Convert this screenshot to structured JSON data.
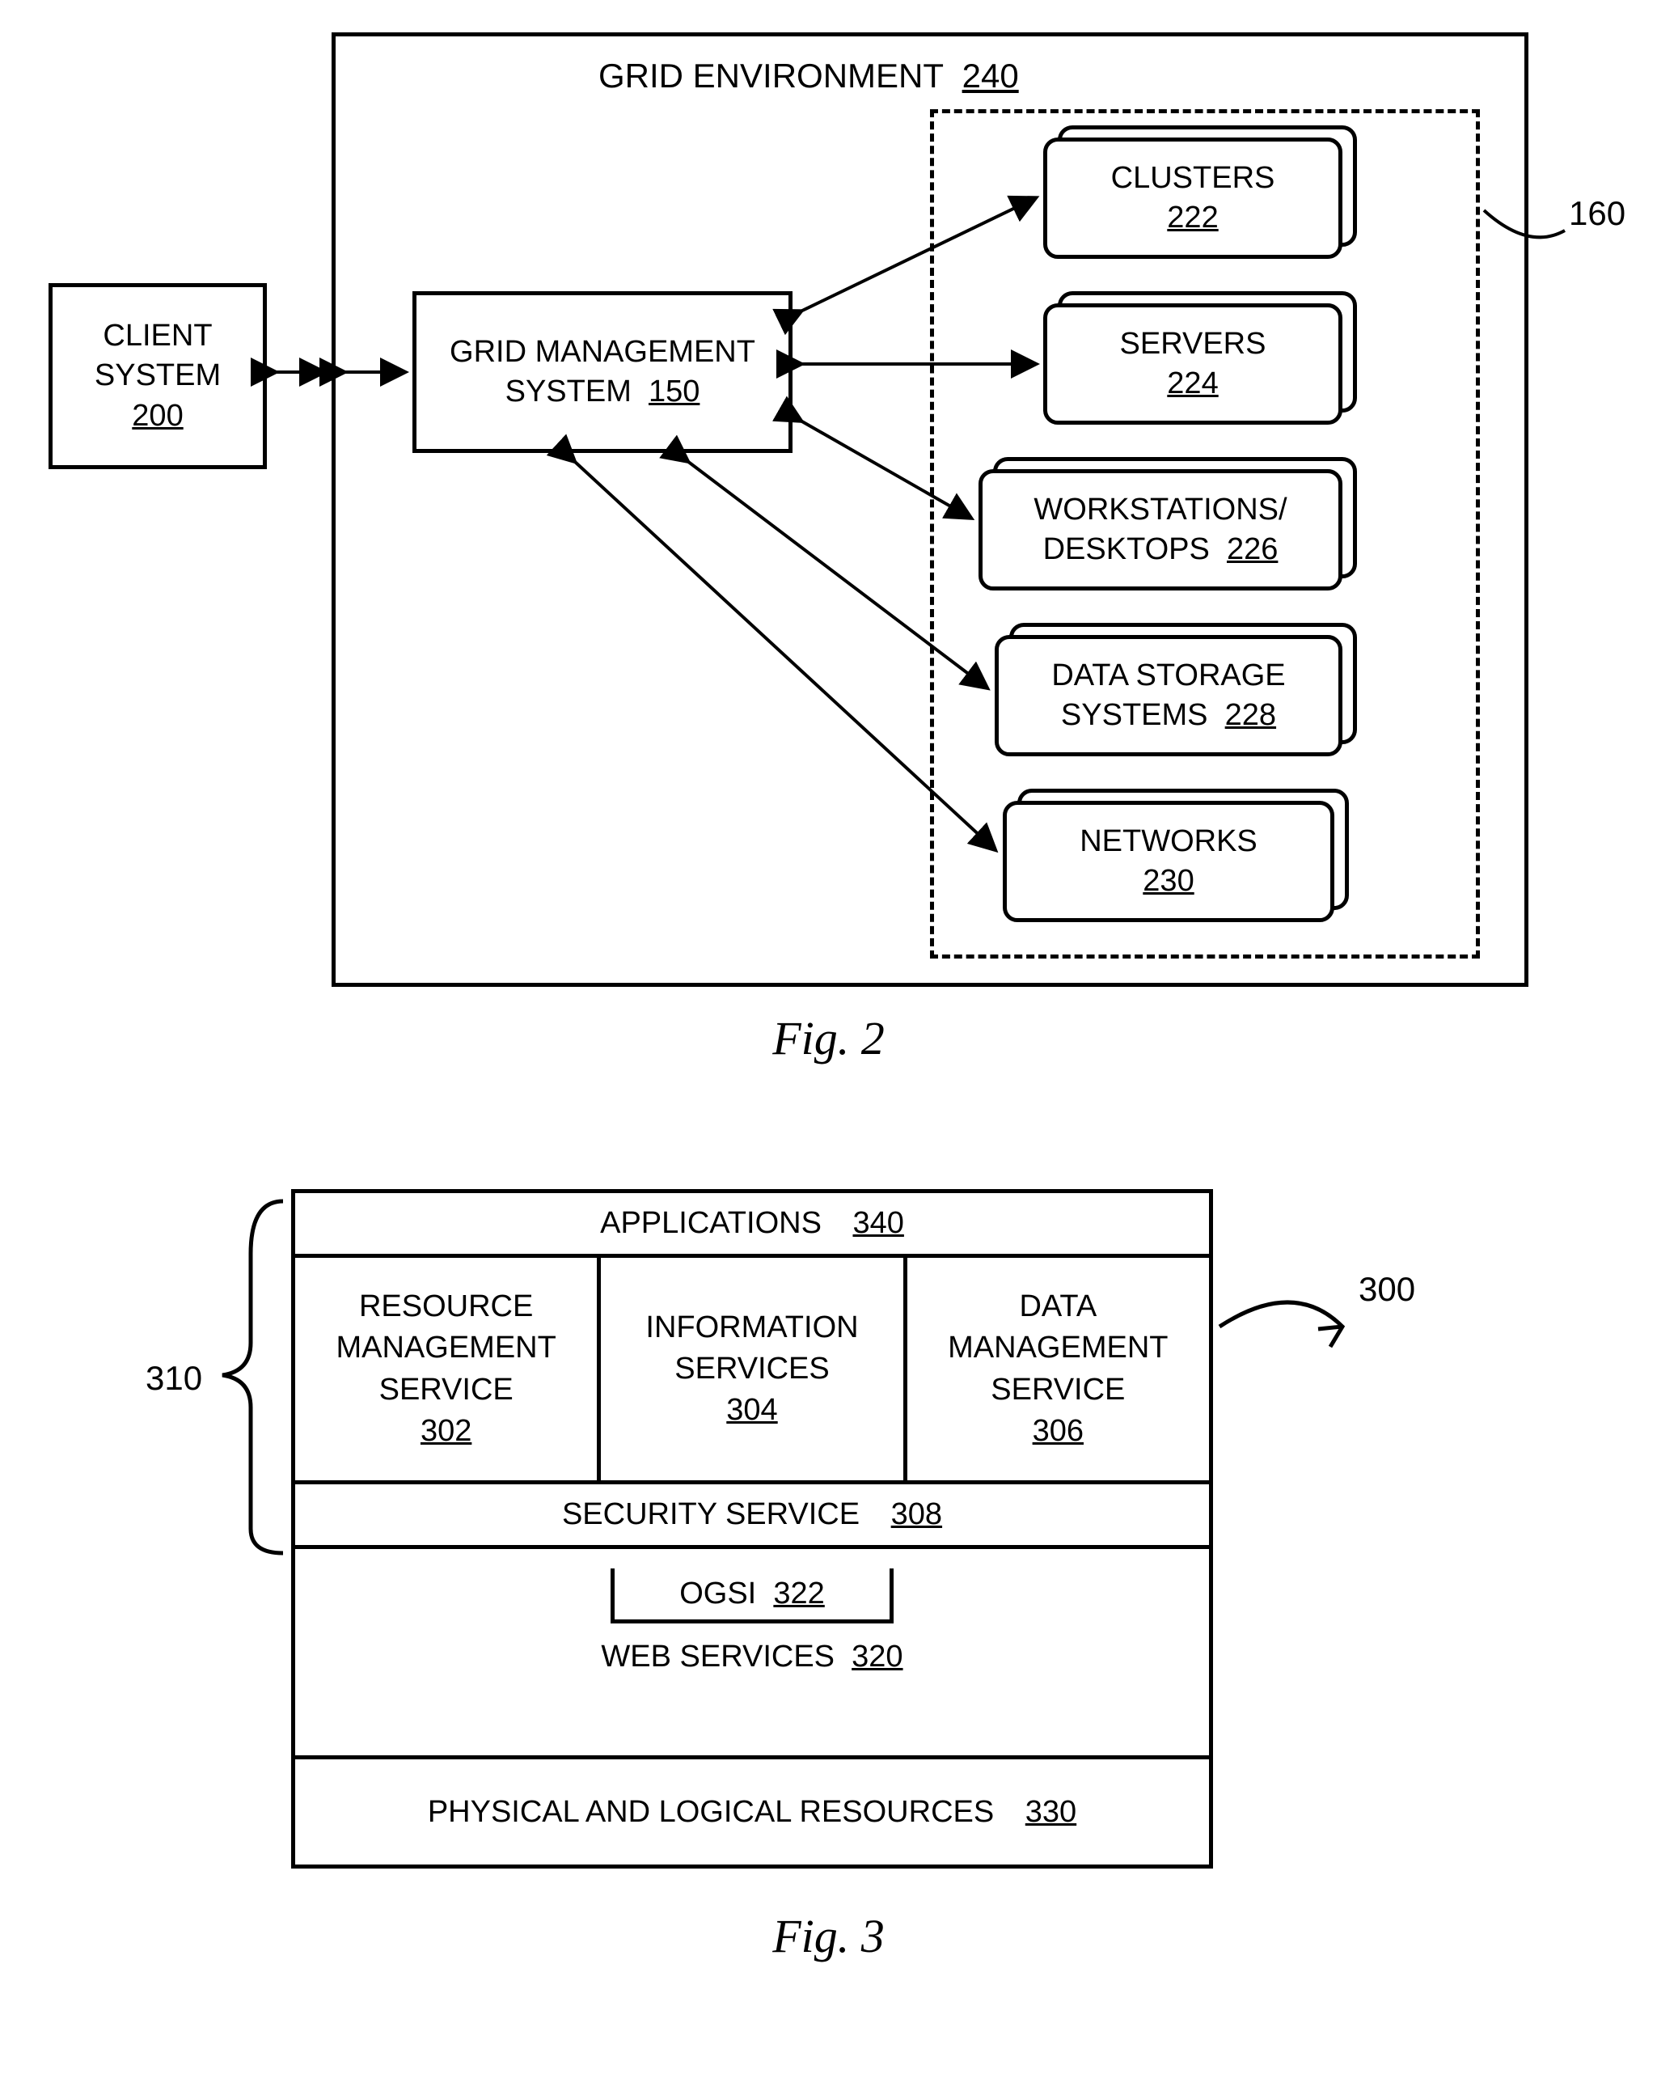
{
  "fig2": {
    "caption": "Fig. 2",
    "env_title": "GRID ENVIRONMENT",
    "env_ref": "240",
    "client": {
      "l1": "CLIENT",
      "l2": "SYSTEM",
      "ref": "200"
    },
    "gms": {
      "l1": "GRID MANAGEMENT",
      "l2": "SYSTEM",
      "ref": "150"
    },
    "resources_ref": "160",
    "resources": [
      {
        "label": "CLUSTERS",
        "ref": "222"
      },
      {
        "label": "SERVERS",
        "ref": "224"
      },
      {
        "label_l1": "WORKSTATIONS/",
        "label_l2": "DESKTOPS",
        "ref": "226"
      },
      {
        "label_l1": "DATA STORAGE",
        "label_l2": "SYSTEMS",
        "ref": "228"
      },
      {
        "label": "NETWORKS",
        "ref": "230"
      }
    ]
  },
  "fig3": {
    "caption": "Fig. 3",
    "stack_ref": "300",
    "brace_ref": "310",
    "rows": {
      "applications": {
        "label": "APPLICATIONS",
        "ref": "340"
      },
      "services": [
        {
          "l1": "RESOURCE",
          "l2": "MANAGEMENT",
          "l3": "SERVICE",
          "ref": "302"
        },
        {
          "l1": "INFORMATION",
          "l2": "SERVICES",
          "ref": "304"
        },
        {
          "l1": "DATA",
          "l2": "MANAGEMENT",
          "l3": "SERVICE",
          "ref": "306"
        }
      ],
      "security": {
        "label": "SECURITY SERVICE",
        "ref": "308"
      },
      "ogsi": {
        "label": "OGSI",
        "ref": "322"
      },
      "web": {
        "label": "WEB SERVICES",
        "ref": "320"
      },
      "phys": {
        "label": "PHYSICAL AND LOGICAL RESOURCES",
        "ref": "330"
      }
    }
  }
}
